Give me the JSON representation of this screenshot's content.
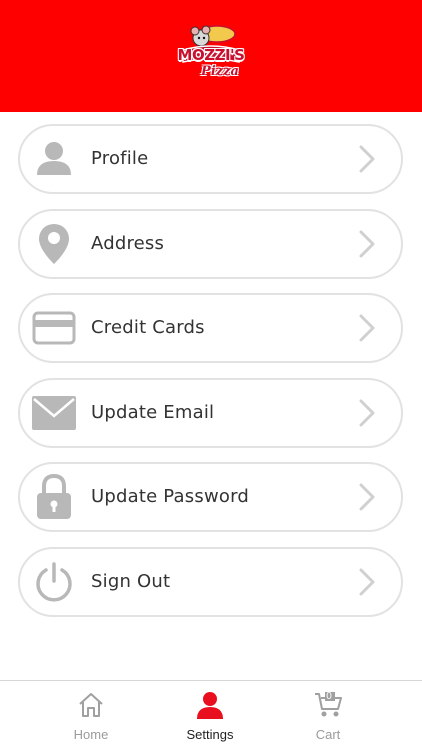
{
  "header": {
    "logo_text": "MOZZI'S",
    "logo_script": "Pizza",
    "brand_color": "#ff0000"
  },
  "menu": {
    "items": [
      {
        "label": "Profile",
        "icon": "person-icon"
      },
      {
        "label": "Address",
        "icon": "location-pin-icon"
      },
      {
        "label": "Credit Cards",
        "icon": "credit-card-icon"
      },
      {
        "label": "Update Email",
        "icon": "envelope-icon"
      },
      {
        "label": "Update Password",
        "icon": "lock-icon"
      },
      {
        "label": "Sign Out",
        "icon": "power-icon"
      }
    ]
  },
  "tabbar": {
    "home_label": "Home",
    "settings_label": "Settings",
    "cart_label": "Cart",
    "cart_count": "0",
    "active_tab": "Settings",
    "active_color": "#e8101f"
  }
}
